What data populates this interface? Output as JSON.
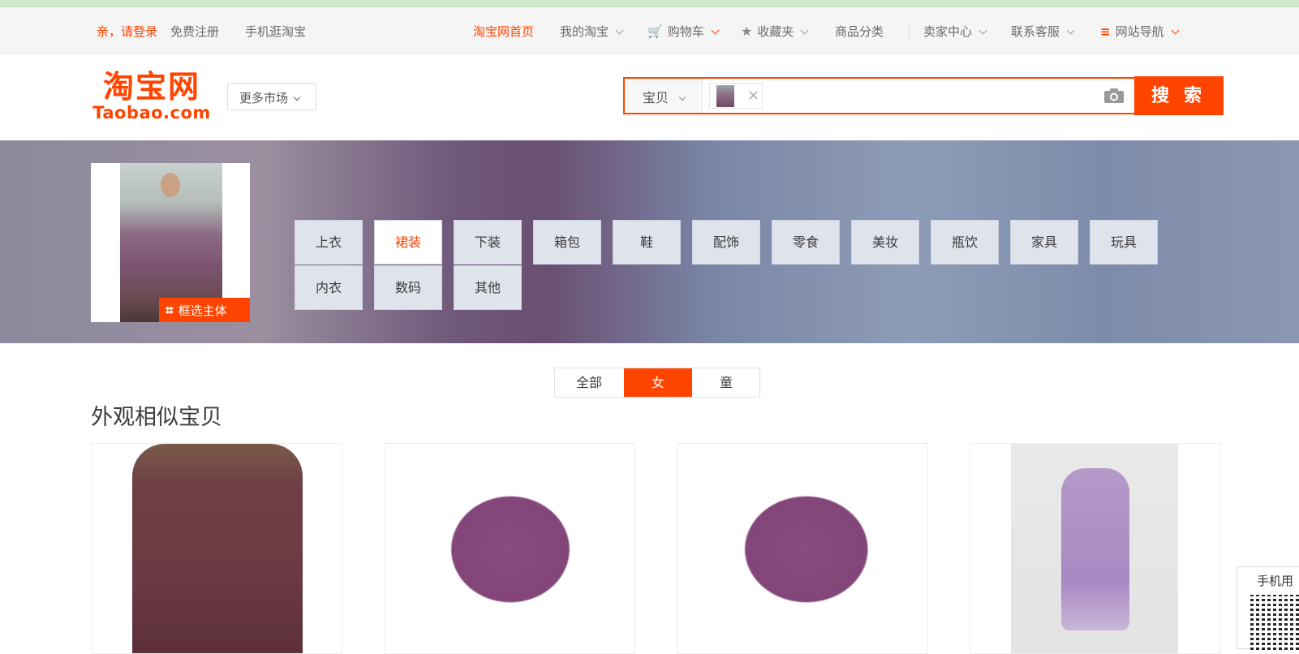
{
  "sitenav": {
    "login": "亲，请登录",
    "register": "免费注册",
    "mobile": "手机逛淘宝",
    "home": "淘宝网首页",
    "my_taobao": "我的淘宝",
    "cart": "购物车",
    "favorites": "收藏夹",
    "categories": "商品分类",
    "seller": "卖家中心",
    "service": "联系客服",
    "site_nav": "网站导航"
  },
  "header": {
    "logo_cn": "淘宝网",
    "logo_en": "Taobao.com",
    "more_markets": "更多市场",
    "search_type": "宝贝",
    "search_value": "",
    "search_button": "搜 索"
  },
  "banner": {
    "crop_label": "框选主体",
    "categories": [
      "上衣",
      "裙装",
      "下装",
      "箱包",
      "鞋",
      "配饰",
      "零食",
      "美妆",
      "瓶饮",
      "家具",
      "玩具",
      "内衣",
      "数码",
      "其他"
    ],
    "active_category": "裙装"
  },
  "filters": {
    "tabs": [
      "全部",
      "女",
      "童"
    ],
    "active": "女"
  },
  "results": {
    "title": "外观相似宝贝"
  },
  "widget": {
    "label": "手机用"
  },
  "colors": {
    "accent": "#ff4400",
    "category_bg": "#dfe3ec"
  }
}
